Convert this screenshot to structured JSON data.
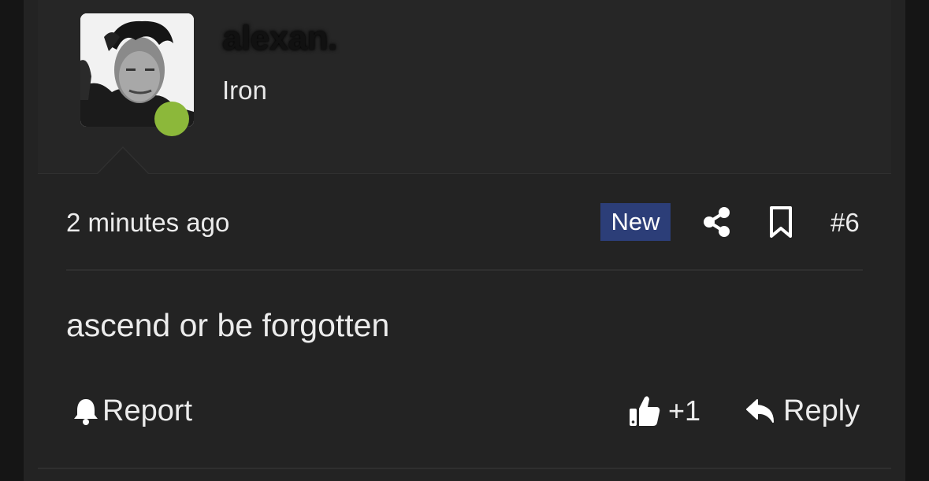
{
  "user": {
    "name": "alexan.",
    "title": "Iron",
    "online": true,
    "status_color": "#8cb83a",
    "avatar_icon": "user-photo"
  },
  "meta": {
    "timestamp": "2 minutes ago",
    "badge": "New",
    "badge_color": "#2c3e78",
    "share_icon": "share-icon",
    "bookmark_icon": "bookmark-icon",
    "post_number": "#6"
  },
  "post": {
    "body": "ascend or be forgotten"
  },
  "actions": {
    "report_label": "Report",
    "like_count": "+1",
    "reply_label": "Reply"
  }
}
